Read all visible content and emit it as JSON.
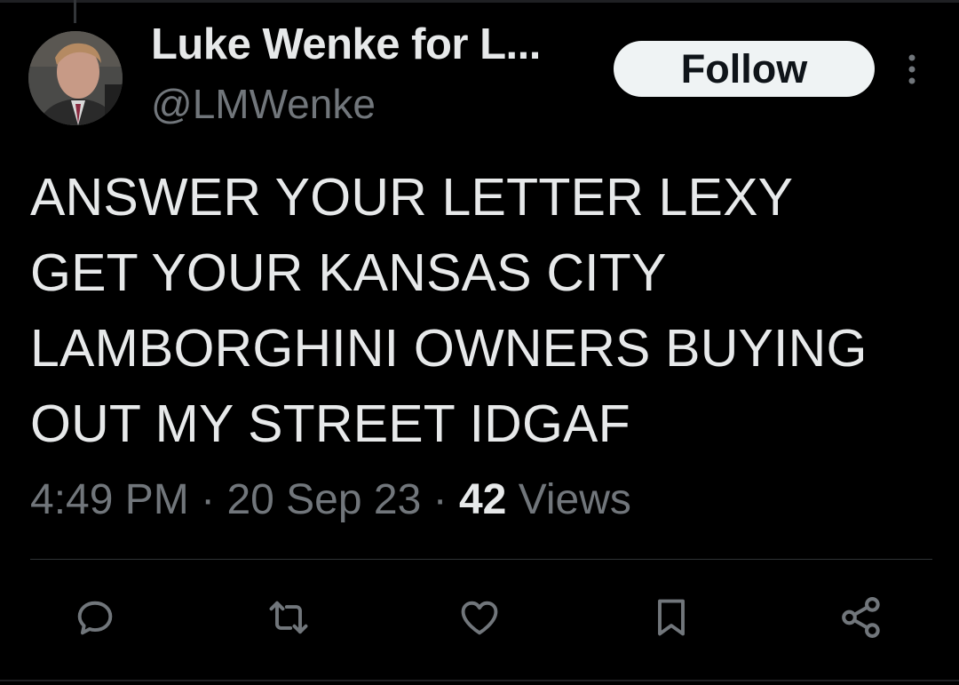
{
  "tweet": {
    "author": {
      "display_name": "Luke Wenke for L...",
      "handle": "@LMWenke"
    },
    "follow_label": "Follow",
    "text": "ANSWER YOUR LETTER LEXY\nGET YOUR KANSAS CITY\nLAMBORGHINI OWNERS BUYING\nOUT MY STREET IDGAF",
    "time": "4:49 PM",
    "date": "20 Sep 23",
    "separator": "·",
    "views_count": "42",
    "views_label": "Views"
  },
  "actions": [
    {
      "icon": "reply-icon"
    },
    {
      "icon": "retweet-icon"
    },
    {
      "icon": "like-icon"
    },
    {
      "icon": "bookmark-icon"
    },
    {
      "icon": "share-icon"
    }
  ],
  "colors": {
    "background": "#000000",
    "primary_text": "#e7e9ea",
    "secondary_text": "#71767b",
    "follow_bg": "#eff3f4",
    "follow_text": "#0f1419",
    "divider": "#2f3336"
  }
}
